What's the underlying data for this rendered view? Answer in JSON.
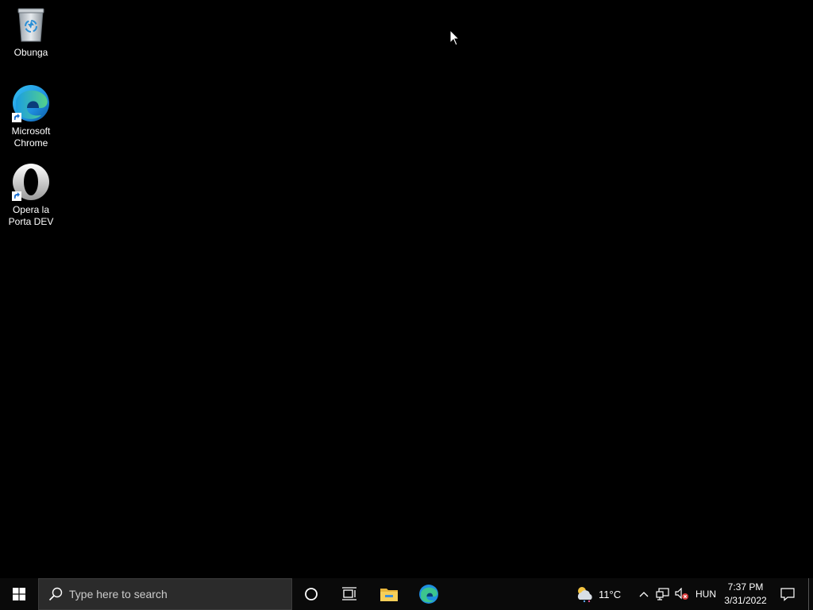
{
  "desktop": {
    "icons": [
      {
        "label": "Obunga",
        "icon": "recycle-bin-icon"
      },
      {
        "label": "Microsoft\nChrome",
        "icon": "edge-browser-icon"
      },
      {
        "label": "Opera la\nPorta DEV",
        "icon": "opera-browser-icon"
      }
    ],
    "background_color": "#000000"
  },
  "taskbar": {
    "start_icon": "windows-logo-icon",
    "search": {
      "placeholder": "Type here to search",
      "icon": "search-icon"
    },
    "cortana_icon": "cortana-circle-icon",
    "taskview_icon": "task-view-icon",
    "pinned": [
      {
        "name": "File Explorer",
        "icon": "folder-icon"
      },
      {
        "name": "Microsoft Edge",
        "icon": "edge-browser-icon"
      }
    ],
    "tray": {
      "weather_temp": "11°C",
      "weather_icon": "weather-cloud-icon",
      "chevron_icon": "chevron-up-icon",
      "network_icon": "network-icon",
      "volume_icon": "volume-muted-icon",
      "language": "HUN",
      "time": "7:37 PM",
      "date": "3/31/2022",
      "notification_icon": "notification-icon"
    },
    "accent_color": "#0078d4"
  }
}
